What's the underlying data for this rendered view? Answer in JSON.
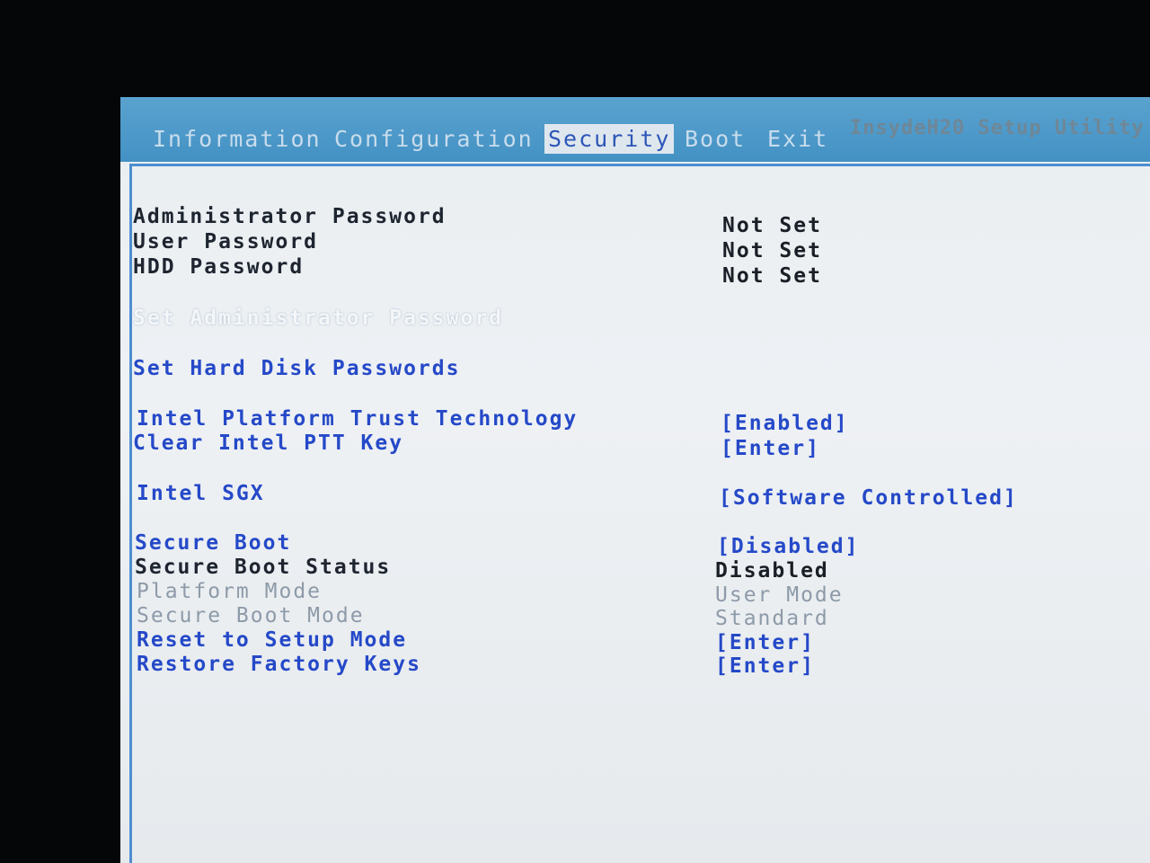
{
  "menu": {
    "tabs": [
      "Information",
      "Configuration",
      "Security",
      "Boot",
      "Exit"
    ],
    "active": "Security",
    "product": "InsydeH20 Setup Utility"
  },
  "items": [
    {
      "label": "Administrator Password",
      "value": "Not Set",
      "style": "static"
    },
    {
      "label": "User Password",
      "value": "Not Set",
      "style": "static"
    },
    {
      "label": "HDD Password",
      "value": "Not Set",
      "style": "static"
    },
    {
      "label": "Set Administrator Password",
      "value": "",
      "style": "selected"
    },
    {
      "label": "Set Hard Disk Passwords",
      "value": "",
      "style": "link"
    },
    {
      "label": "Intel Platform Trust Technology",
      "value": "[Enabled]",
      "style": "link"
    },
    {
      "label": "Clear Intel PTT Key",
      "value": "[Enter]",
      "style": "link"
    },
    {
      "label": "Intel SGX",
      "value": "[Software Controlled]",
      "style": "link"
    },
    {
      "label": "Secure Boot",
      "value": "[Disabled]",
      "style": "link"
    },
    {
      "label": "Secure Boot Status",
      "value": "Disabled",
      "style": "static"
    },
    {
      "label": "Platform Mode",
      "value": "User Mode",
      "style": "grey"
    },
    {
      "label": "Secure Boot Mode",
      "value": "Standard",
      "style": "grey"
    },
    {
      "label": "Reset to Setup Mode",
      "value": "[Enter]",
      "style": "link"
    },
    {
      "label": "Restore Factory Keys",
      "value": "[Enter]",
      "style": "link"
    }
  ]
}
